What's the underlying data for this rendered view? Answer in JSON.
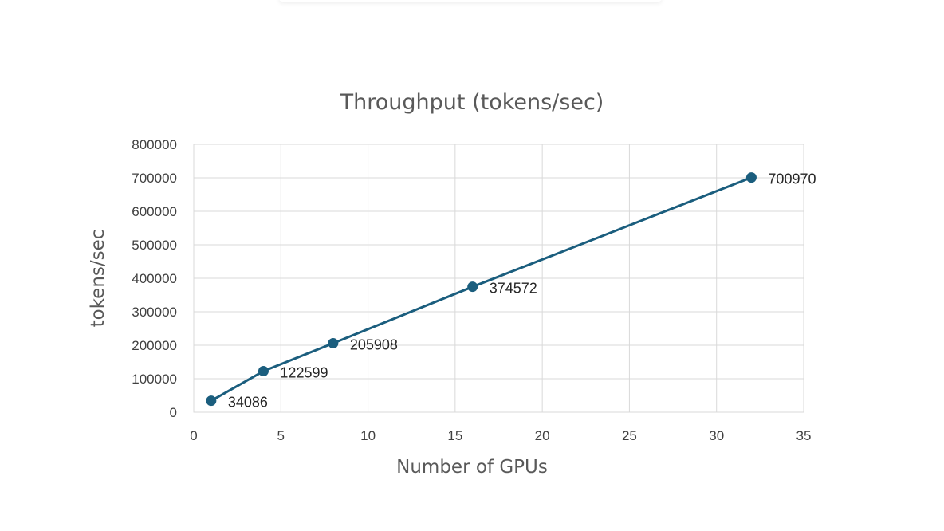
{
  "chart_data": {
    "type": "line",
    "title": "Throughput (tokens/sec)",
    "xlabel": "Number of GPUs",
    "ylabel": "tokens/sec",
    "xlim": [
      0,
      35
    ],
    "ylim": [
      0,
      800000
    ],
    "xticks": [
      0,
      5,
      10,
      15,
      20,
      25,
      30,
      35
    ],
    "yticks": [
      0,
      100000,
      200000,
      300000,
      400000,
      500000,
      600000,
      700000,
      800000
    ],
    "grid": true,
    "legend": "none",
    "color": "#1b5e7e",
    "series": [
      {
        "x": [
          1,
          4,
          8,
          16,
          32
        ],
        "y": [
          34086,
          122599,
          205908,
          374572,
          700970
        ],
        "labels": [
          "34086",
          "122599",
          "205908",
          "374572",
          "700970"
        ]
      }
    ]
  }
}
